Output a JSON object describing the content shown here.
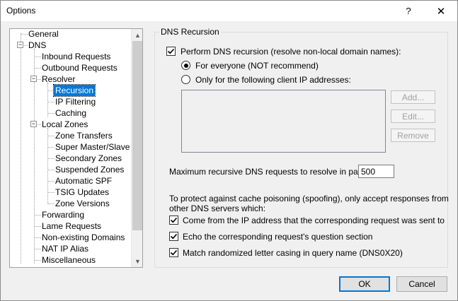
{
  "window": {
    "title": "Options",
    "help": "?",
    "close": "✕"
  },
  "tree": {
    "items": [
      {
        "label": "General"
      },
      {
        "label": "DNS"
      },
      {
        "label": "Inbound Requests"
      },
      {
        "label": "Outbound Requests"
      },
      {
        "label": "Resolver"
      },
      {
        "label": "Recursion"
      },
      {
        "label": "IP Filtering"
      },
      {
        "label": "Caching"
      },
      {
        "label": "Local Zones"
      },
      {
        "label": "Zone Transfers"
      },
      {
        "label": "Super Master/Slave"
      },
      {
        "label": "Secondary Zones"
      },
      {
        "label": "Suspended Zones"
      },
      {
        "label": "Automatic SPF"
      },
      {
        "label": "TSIG Updates"
      },
      {
        "label": "Zone Versions"
      },
      {
        "label": "Forwarding"
      },
      {
        "label": "Lame Requests"
      },
      {
        "label": "Non-existing Domains"
      },
      {
        "label": "NAT IP Alias"
      },
      {
        "label": "Miscellaneous"
      }
    ],
    "selected": "Recursion",
    "expander_minus": "−",
    "scroll_up": "▲",
    "scroll_down": "▼"
  },
  "panel": {
    "group_title": "DNS Recursion",
    "perform_recursion": {
      "label": "Perform DNS recursion (resolve non-local domain names):",
      "checked": true
    },
    "radio_everyone": {
      "label": "For everyone (NOT recommend)",
      "selected": true
    },
    "radio_clients": {
      "label": "Only for the following client IP addresses:",
      "selected": false
    },
    "buttons": {
      "add": "Add...",
      "edit": "Edit...",
      "remove": "Remove"
    },
    "max_requests": {
      "label": "Maximum recursive DNS requests to resolve in parallel:",
      "value": "500"
    },
    "spoof_text_1": "To protect against cache poisoning (spoofing), only accept responses from",
    "spoof_text_2": "other DNS servers which:",
    "check_ip": {
      "label": "Come from the IP address that the corresponding request was sent to",
      "checked": true
    },
    "check_echo": {
      "label": "Echo the corresponding request's question section",
      "checked": true
    },
    "check_case": {
      "label": "Match randomized letter casing in query name (DNS0X20)",
      "checked": true
    }
  },
  "footer": {
    "ok": "OK",
    "cancel": "Cancel"
  },
  "colors": {
    "selection": "#0078d7",
    "background": "#f0f0f0"
  }
}
